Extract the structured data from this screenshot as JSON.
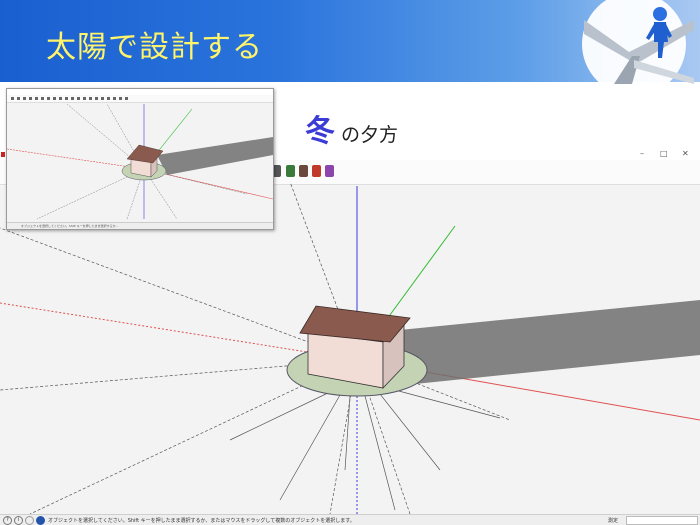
{
  "banner": {
    "title": "太陽で設計する"
  },
  "caption": {
    "season": "冬",
    "time": "の夕方"
  },
  "main_window": {
    "status_text": "オブジェクトを選択してください。Shift キーを押したまま選択するか、またはマウスをドラッグして複数のオブジェクトを選択します。",
    "measure_label": "測定",
    "status_icon_help": "?",
    "status_icon_info": "i"
  },
  "thumbnail_window": {
    "status_text": "オブジェクトを選択してください。Shift キーを押したまま選択するか…"
  },
  "colors": {
    "banner_start": "#1a5fd0",
    "title_yellow": "#fff46a",
    "season_blue": "#3b3bd6",
    "roof": "#8a5a4e",
    "wall": "#f2dcd6",
    "ground_disc": "#c4d3b3",
    "shadow": "#6e6e6e",
    "axis_blue": "#3a3ae0",
    "axis_green": "#33bb33",
    "axis_red": "#e05050"
  },
  "icons": [
    "person-on-arrow-logo-icon",
    "help-icon",
    "info-icon",
    "minimize-icon",
    "maximize-icon",
    "close-icon"
  ]
}
